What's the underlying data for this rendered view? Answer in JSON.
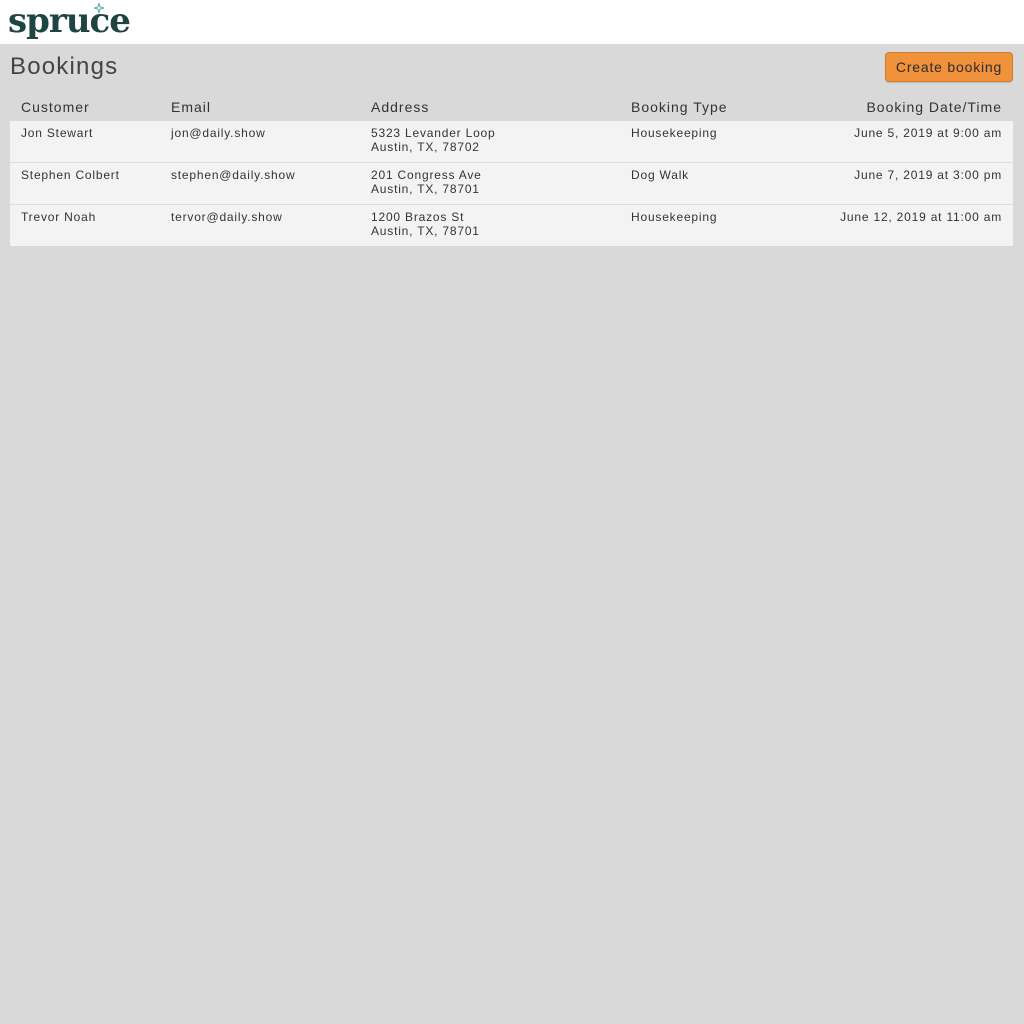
{
  "header": {
    "logo_text": "spruce",
    "logo_star_color": "#5aaea0",
    "logo_color": "#1f4444"
  },
  "page": {
    "title": "Bookings",
    "create_button_label": "Create booking",
    "accent_color": "#f0913b"
  },
  "table": {
    "columns": [
      "Customer",
      "Email",
      "Address",
      "Booking Type",
      "Booking Date/Time"
    ],
    "rows": [
      {
        "customer": "Jon Stewart",
        "email": "jon@daily.show",
        "address_line1": "5323 Levander Loop",
        "address_line2": "Austin, TX, 78702",
        "booking_type": "Housekeeping",
        "datetime": "June 5, 2019 at 9:00 am"
      },
      {
        "customer": "Stephen Colbert",
        "email": "stephen@daily.show",
        "address_line1": "201 Congress Ave",
        "address_line2": "Austin, TX, 78701",
        "booking_type": "Dog Walk",
        "datetime": "June 7, 2019 at 3:00 pm"
      },
      {
        "customer": "Trevor Noah",
        "email": "tervor@daily.show",
        "address_line1": "1200 Brazos St",
        "address_line2": "Austin, TX, 78701",
        "booking_type": "Housekeeping",
        "datetime": "June 12, 2019 at 11:00 am"
      }
    ]
  }
}
